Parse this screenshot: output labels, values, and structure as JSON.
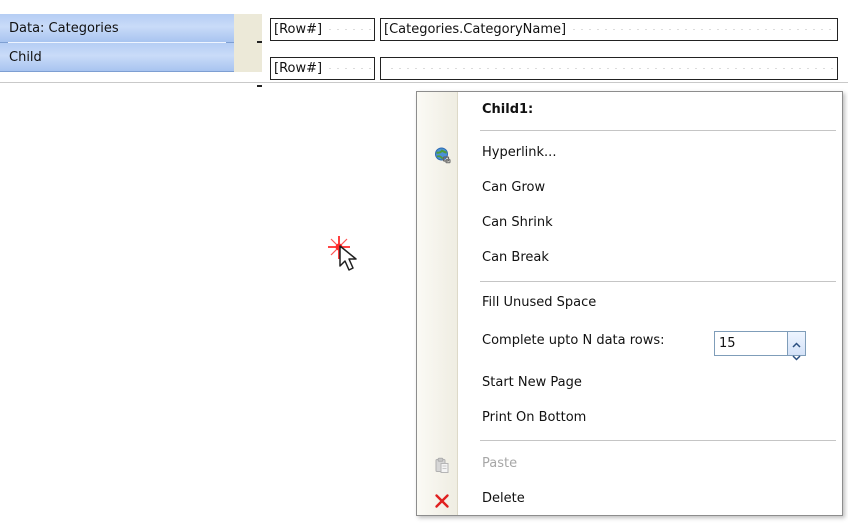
{
  "bands": {
    "data_band_label": "Data: Categories",
    "child_band_label": "Child",
    "row1": {
      "row_field": "[Row#]",
      "name_field": "[Categories.CategoryName]"
    },
    "row2": {
      "row_field": "[Row#]",
      "name_field": ""
    }
  },
  "menu": {
    "title": "Child1:",
    "items": {
      "hyperlink": "Hyperlink...",
      "can_grow": "Can Grow",
      "can_shrink": "Can Shrink",
      "can_break": "Can Break",
      "fill_unused_space": "Fill Unused Space",
      "complete_rows": "Complete upto N data rows:",
      "start_new_page": "Start New Page",
      "print_on_bottom": "Print On Bottom",
      "paste": "Paste",
      "delete": "Delete"
    },
    "complete_rows_value": "15"
  },
  "icons": {
    "hyperlink": "globe-link-icon",
    "paste": "paste-icon",
    "delete": "delete-x-icon",
    "spin_up": "chevron-up-icon",
    "spin_down": "chevron-down-icon",
    "cursor": "mouse-pointer-icon"
  },
  "colors": {
    "band_header": "#b5cdf4",
    "menu_gutter": "#efede2",
    "delete_red": "#e02020",
    "accent_blue": "#7f9db9"
  }
}
